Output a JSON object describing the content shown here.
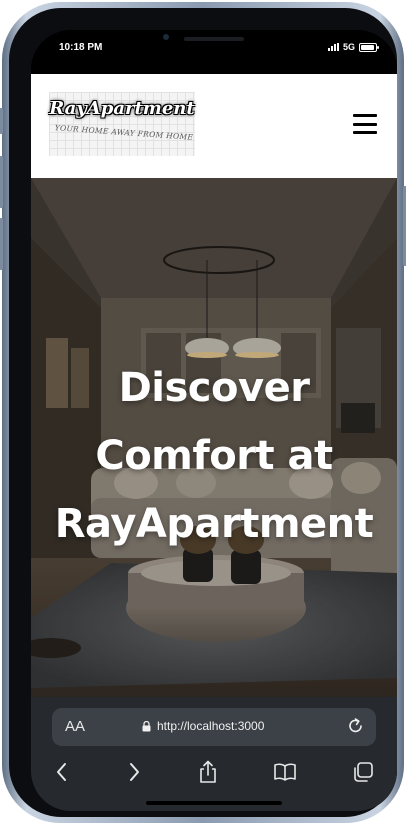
{
  "status_bar": {
    "time": "10:18 PM",
    "network": "5G",
    "battery_level": 0.9
  },
  "header": {
    "logo_title": "RayApartment",
    "logo_tagline": "YOUR HOME AWAY FROM HOME",
    "menu_icon": "hamburger-icon"
  },
  "hero": {
    "title_line1": "Discover",
    "title_line2": "Comfort at",
    "title_line3": "RayApartment"
  },
  "browser": {
    "text_size_label": "AA",
    "url": "http://localhost:3000",
    "icons": [
      "lock-icon",
      "reload-icon",
      "back-icon",
      "forward-icon",
      "share-icon",
      "bookmarks-icon",
      "tabs-icon"
    ]
  },
  "colors": {
    "header_bg": "#ffffff",
    "toolbar_bg": "#262a2f",
    "hero_text": "#ffffff"
  }
}
